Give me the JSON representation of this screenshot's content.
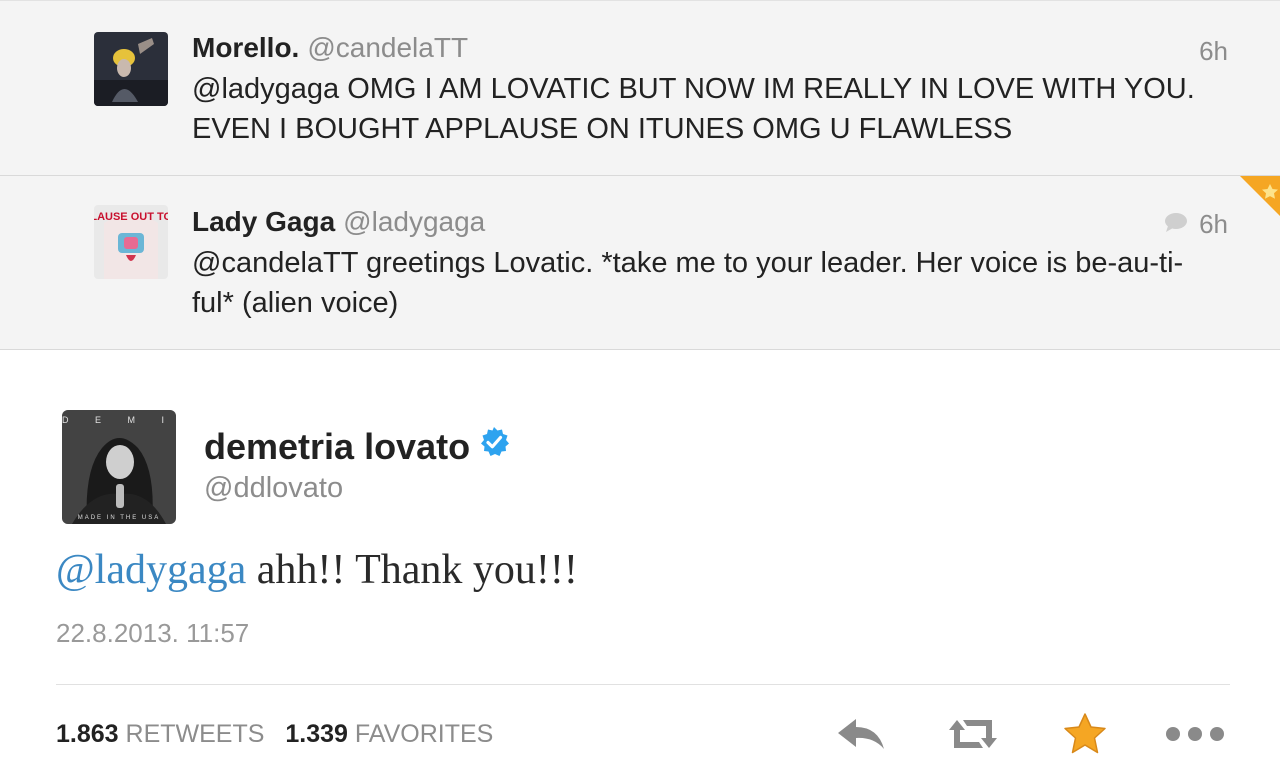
{
  "tweets": [
    {
      "name": "Morello.",
      "handle": "@candelaTT",
      "time": "6h",
      "text": "@ladygaga OMG I AM LOVATIC BUT NOW IM REALLY IN LOVE WITH YOU. EVEN I BOUGHT APPLAUSE ON ITUNES OMG U FLAWLESS"
    },
    {
      "name": "Lady Gaga",
      "handle": "@ladygaga",
      "time": "6h",
      "text": "@candelaTT greetings Lovatic. *take me to your leader. Her voice is be-au-ti-ful* (alien voice)",
      "avatar_text": "APPLAUSE OUT TODAY"
    }
  ],
  "main_tweet": {
    "name": "demetria lovato",
    "handle": "@ddlovato",
    "mention": "@ladygaga",
    "text_rest": " ahh!! Thank you!!!",
    "date": "22.8.2013. 11:57",
    "avatar_text": "D E M I",
    "avatar_bottom_text": "MADE IN THE USA",
    "retweets_count": "1.863",
    "retweets_label": "RETWEETS",
    "favorites_count": "1.339",
    "favorites_label": "FAVORITES"
  },
  "colors": {
    "mention": "#3b88c3",
    "verified": "#2ea3ef",
    "favorite_star": "#f5a623",
    "action_gray": "#888888"
  },
  "icons": [
    "reply-icon",
    "retweet-icon",
    "favorite-star-icon",
    "more-icon",
    "verified-icon",
    "conversation-icon"
  ]
}
